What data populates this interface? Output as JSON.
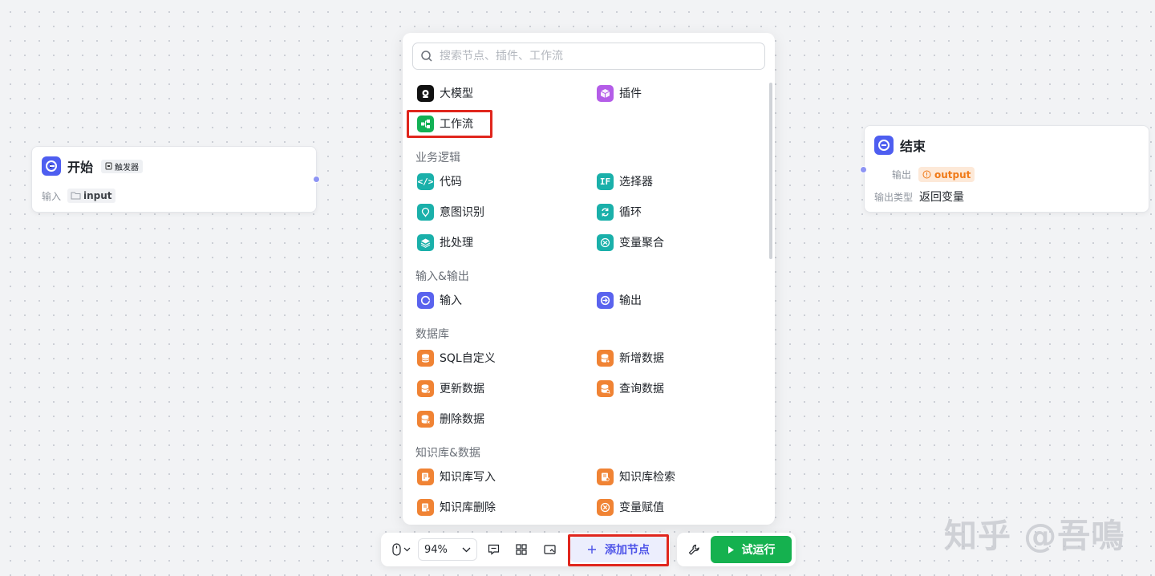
{
  "start_node": {
    "title": "开始",
    "tag": "触发器",
    "row_label": "输入",
    "variable": "input"
  },
  "end_node": {
    "title": "结束",
    "output_label": "输出",
    "output_variable": "output",
    "output_type_label": "输出类型",
    "output_type_value": "返回变量"
  },
  "panel": {
    "search_placeholder": "搜索节点、插件、工作流",
    "top_items": [
      {
        "label": "大模型",
        "icon": "llm-icon"
      },
      {
        "label": "插件",
        "icon": "plugin-cube-icon"
      },
      {
        "label": "工作流",
        "icon": "workflow-icon"
      }
    ],
    "sections": [
      {
        "title": "业务逻辑",
        "items": [
          {
            "label": "代码",
            "icon": "code-icon"
          },
          {
            "label": "选择器",
            "icon": "if-selector-icon"
          },
          {
            "label": "意图识别",
            "icon": "intent-icon"
          },
          {
            "label": "循环",
            "icon": "loop-icon"
          },
          {
            "label": "批处理",
            "icon": "batch-layers-icon"
          },
          {
            "label": "变量聚合",
            "icon": "variable-merge-icon"
          }
        ]
      },
      {
        "title": "输入&输出",
        "items": [
          {
            "label": "输入",
            "icon": "input-icon"
          },
          {
            "label": "输出",
            "icon": "output-icon"
          }
        ]
      },
      {
        "title": "数据库",
        "items": [
          {
            "label": "SQL自定义",
            "icon": "database-icon"
          },
          {
            "label": "新增数据",
            "icon": "database-add-icon"
          },
          {
            "label": "更新数据",
            "icon": "database-update-icon"
          },
          {
            "label": "查询数据",
            "icon": "database-query-icon"
          },
          {
            "label": "删除数据",
            "icon": "database-delete-icon"
          }
        ]
      },
      {
        "title": "知识库&数据",
        "items": [
          {
            "label": "知识库写入",
            "icon": "knowledge-write-icon"
          },
          {
            "label": "知识库检索",
            "icon": "knowledge-search-icon"
          },
          {
            "label": "知识库删除",
            "icon": "knowledge-delete-icon"
          },
          {
            "label": "变量赋值",
            "icon": "variable-assign-icon"
          }
        ]
      }
    ]
  },
  "toolbar": {
    "zoom": "94%",
    "add_node_label": "添加节点",
    "run_label": "试运行"
  },
  "watermark": "知乎 @吾鳴",
  "colors": {
    "accent": "#4d53e8",
    "run_green": "#15b14f",
    "highlight_red": "#e0261d",
    "output_orange": "#f07a18"
  }
}
